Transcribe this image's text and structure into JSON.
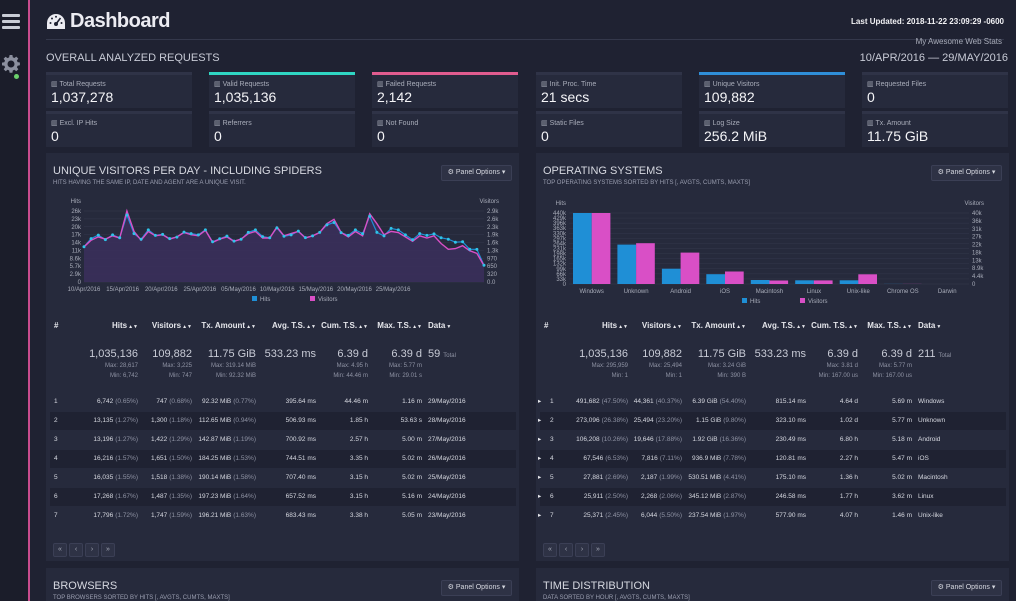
{
  "header": {
    "title": "Dashboard",
    "last_updated": "Last Updated: 2018-11-22 23:09:29 -0600",
    "site_name": "My Awesome Web Stats"
  },
  "overall": {
    "title": "OVERALL ANALYZED REQUESTS",
    "date_range": "10/APR/2016 — 29/MAY/2016",
    "cards": [
      {
        "label": "Total Requests",
        "value": "1,037,278",
        "accent": ""
      },
      {
        "label": "Valid Requests",
        "value": "1,035,136",
        "accent": "#2fd6c3"
      },
      {
        "label": "Failed Requests",
        "value": "2,142",
        "accent": "#e05c8f"
      },
      {
        "label": "Init. Proc. Time",
        "value": "21 secs",
        "accent": ""
      },
      {
        "label": "Unique Visitors",
        "value": "109,882",
        "accent": "#2f8ed8"
      },
      {
        "label": "Requested Files",
        "value": "0",
        "accent": ""
      },
      {
        "label": "Excl. IP Hits",
        "value": "0",
        "accent": ""
      },
      {
        "label": "Referrers",
        "value": "0",
        "accent": ""
      },
      {
        "label": "Not Found",
        "value": "0",
        "accent": ""
      },
      {
        "label": "Static Files",
        "value": "0",
        "accent": ""
      },
      {
        "label": "Log Size",
        "value": "256.2 MiB",
        "accent": ""
      },
      {
        "label": "Tx. Amount",
        "value": "11.75 GiB",
        "accent": ""
      }
    ]
  },
  "panel_options_label": "Panel Options",
  "colors": {
    "hits": "#1f8fd6",
    "visitors": "#d94fc6",
    "visitors_area": "#3b2f5c"
  },
  "visitors_panel": {
    "title": "UNIQUE VISITORS PER DAY - INCLUDING SPIDERS",
    "subtitle": "HITS HAVING THE SAME IP, DATE AND AGENT ARE A UNIQUE VISIT.",
    "columns": [
      "#",
      "Hits",
      "Visitors",
      "Tx. Amount",
      "Avg. T.S.",
      "Cum. T.S.",
      "Max. T.S.",
      "Data"
    ],
    "totals": {
      "hits": "1,035,136",
      "hits_max": "Max: 28,617",
      "hits_min": "Min: 6,742",
      "visitors": "109,882",
      "visitors_max": "Max: 3,225",
      "visitors_min": "Min: 747",
      "tx": "11.75 GiB",
      "tx_max": "Max: 319.14 MiB",
      "tx_min": "Min: 92.32 MiB",
      "avg": "533.23 ms",
      "cum": "6.39 d",
      "cum_max": "Max: 4.95 h",
      "cum_min": "Min: 44.46 m",
      "max": "6.39 d",
      "max_max": "Max: 5.77 m",
      "max_min": "Min: 29.01 s",
      "data": "59",
      "data_label": "Total"
    },
    "rows": [
      {
        "n": "1",
        "hits": "6,742",
        "hits_pct": "(0.65%)",
        "visitors": "747",
        "visitors_pct": "(0.68%)",
        "tx": "92.32 MiB",
        "tx_pct": "(0.77%)",
        "avg": "395.64 ms",
        "cum": "44.46 m",
        "max": "1.16 m",
        "data": "29/May/2016"
      },
      {
        "n": "2",
        "hits": "13,135",
        "hits_pct": "(1.27%)",
        "visitors": "1,300",
        "visitors_pct": "(1.18%)",
        "tx": "112.65 MiB",
        "tx_pct": "(0.94%)",
        "avg": "506.93 ms",
        "cum": "1.85 h",
        "max": "53.63 s",
        "data": "28/May/2016"
      },
      {
        "n": "3",
        "hits": "13,196",
        "hits_pct": "(1.27%)",
        "visitors": "1,422",
        "visitors_pct": "(1.29%)",
        "tx": "142.87 MiB",
        "tx_pct": "(1.19%)",
        "avg": "700.92 ms",
        "cum": "2.57 h",
        "max": "5.00 m",
        "data": "27/May/2016"
      },
      {
        "n": "4",
        "hits": "16,216",
        "hits_pct": "(1.57%)",
        "visitors": "1,651",
        "visitors_pct": "(1.50%)",
        "tx": "184.25 MiB",
        "tx_pct": "(1.53%)",
        "avg": "744.51 ms",
        "cum": "3.35 h",
        "max": "5.02 m",
        "data": "26/May/2016"
      },
      {
        "n": "5",
        "hits": "16,035",
        "hits_pct": "(1.55%)",
        "visitors": "1,518",
        "visitors_pct": "(1.38%)",
        "tx": "190.14 MiB",
        "tx_pct": "(1.58%)",
        "avg": "707.40 ms",
        "cum": "3.15 h",
        "max": "5.02 m",
        "data": "25/May/2016"
      },
      {
        "n": "6",
        "hits": "17,268",
        "hits_pct": "(1.67%)",
        "visitors": "1,487",
        "visitors_pct": "(1.35%)",
        "tx": "197.23 MiB",
        "tx_pct": "(1.64%)",
        "avg": "657.52 ms",
        "cum": "3.15 h",
        "max": "5.16 m",
        "data": "24/May/2016"
      },
      {
        "n": "7",
        "hits": "17,796",
        "hits_pct": "(1.72%)",
        "visitors": "1,747",
        "visitors_pct": "(1.59%)",
        "tx": "196.21 MiB",
        "tx_pct": "(1.63%)",
        "avg": "683.43 ms",
        "cum": "3.38 h",
        "max": "5.05 m",
        "data": "23/May/2016"
      }
    ],
    "pager": [
      "«",
      "‹",
      "›",
      "»"
    ]
  },
  "os_panel": {
    "title": "OPERATING SYSTEMS",
    "subtitle": "TOP OPERATING SYSTEMS SORTED BY HITS [, AVGTS, CUMTS, MAXTS]",
    "columns": [
      "#",
      "Hits",
      "Visitors",
      "Tx. Amount",
      "Avg. T.S.",
      "Cum. T.S.",
      "Max. T.S.",
      "Data"
    ],
    "totals": {
      "hits": "1,035,136",
      "hits_max": "Max: 295,959",
      "hits_min": "Min: 1",
      "visitors": "109,882",
      "visitors_max": "Max: 25,494",
      "visitors_min": "Min: 1",
      "tx": "11.75 GiB",
      "tx_max": "Max: 3.24 GiB",
      "tx_min": "Min: 390 B",
      "avg": "533.23 ms",
      "cum": "6.39 d",
      "cum_max": "Max: 3.81 d",
      "cum_min": "Min: 167.00 us",
      "max": "6.39 d",
      "max_max": "Max: 5.77 m",
      "max_min": "Min: 167.00 us",
      "data": "211",
      "data_label": "Total"
    },
    "rows": [
      {
        "n": "1",
        "hits": "491,682",
        "hits_pct": "(47.50%)",
        "visitors": "44,361",
        "visitors_pct": "(40.37%)",
        "tx": "6.39 GiB",
        "tx_pct": "(54.40%)",
        "avg": "815.14 ms",
        "cum": "4.64 d",
        "max": "5.69 m",
        "data": "Windows"
      },
      {
        "n": "2",
        "hits": "273,096",
        "hits_pct": "(26.38%)",
        "visitors": "25,494",
        "visitors_pct": "(23.20%)",
        "tx": "1.15 GiB",
        "tx_pct": "(9.80%)",
        "avg": "323.10 ms",
        "cum": "1.02 d",
        "max": "5.77 m",
        "data": "Unknown"
      },
      {
        "n": "3",
        "hits": "106,208",
        "hits_pct": "(10.26%)",
        "visitors": "19,646",
        "visitors_pct": "(17.88%)",
        "tx": "1.92 GiB",
        "tx_pct": "(16.36%)",
        "avg": "230.49 ms",
        "cum": "6.80 h",
        "max": "5.18 m",
        "data": "Android"
      },
      {
        "n": "4",
        "hits": "67,546",
        "hits_pct": "(6.53%)",
        "visitors": "7,816",
        "visitors_pct": "(7.11%)",
        "tx": "936.9 MiB",
        "tx_pct": "(7.78%)",
        "avg": "120.81 ms",
        "cum": "2.27 h",
        "max": "5.47 m",
        "data": "iOS"
      },
      {
        "n": "5",
        "hits": "27,881",
        "hits_pct": "(2.69%)",
        "visitors": "2,187",
        "visitors_pct": "(1.99%)",
        "tx": "530.51 MiB",
        "tx_pct": "(4.41%)",
        "avg": "175.10 ms",
        "cum": "1.36 h",
        "max": "5.02 m",
        "data": "Macintosh"
      },
      {
        "n": "6",
        "hits": "25,911",
        "hits_pct": "(2.50%)",
        "visitors": "2,268",
        "visitors_pct": "(2.06%)",
        "tx": "345.12 MiB",
        "tx_pct": "(2.87%)",
        "avg": "246.58 ms",
        "cum": "1.77 h",
        "max": "3.62 m",
        "data": "Linux"
      },
      {
        "n": "7",
        "hits": "25,371",
        "hits_pct": "(2.45%)",
        "visitors": "6,044",
        "visitors_pct": "(5.50%)",
        "tx": "237.54 MiB",
        "tx_pct": "(1.97%)",
        "avg": "577.90 ms",
        "cum": "4.07 h",
        "max": "1.46 m",
        "data": "Unix-like"
      }
    ],
    "pager": [
      "«",
      "‹",
      "›",
      "»"
    ]
  },
  "browsers_panel": {
    "title": "BROWSERS",
    "subtitle": "TOP BROWSERS SORTED BY HITS [, AVGTS, CUMTS, MAXTS]"
  },
  "time_panel": {
    "title": "TIME DISTRIBUTION",
    "subtitle": "DATA SORTED BY HOUR [, AVGTS, CUMTS, MAXTS]"
  },
  "chart_data": [
    {
      "type": "line",
      "title": "UNIQUE VISITORS PER DAY - INCLUDING SPIDERS",
      "ylabel": "Hits",
      "y2label": "Visitors",
      "yticks": [
        "0",
        "2.9k",
        "5.7k",
        "8.6k",
        "11k",
        "14k",
        "17k",
        "20k",
        "23k",
        "26k"
      ],
      "y2ticks": [
        "0.0",
        "320",
        "650",
        "970",
        "1.3k",
        "1.6k",
        "1.9k",
        "2.3k",
        "2.6k",
        "2.9k"
      ],
      "xticks": [
        "10/Apr/2016",
        "15/Apr/2016",
        "20/Apr/2016",
        "25/Apr/2016",
        "05/May/2016",
        "10/May/2016",
        "15/May/2016",
        "20/May/2016",
        "25/May/2016"
      ],
      "ylim": [
        0,
        28617
      ],
      "y2lim": [
        0,
        3225
      ],
      "legend": [
        "Hits",
        "Visitors"
      ],
      "series": [
        {
          "name": "Hits",
          "values": [
            14200,
            17500,
            18900,
            17100,
            19000,
            17800,
            27000,
            19500,
            17200,
            21000,
            18800,
            19200,
            17500,
            18100,
            20100,
            19500,
            19000,
            21000,
            16200,
            17400,
            18500,
            16500,
            17200,
            20000,
            21000,
            18300,
            17800,
            21800,
            18400,
            19000,
            20500,
            17900,
            18600,
            20000,
            23000,
            24000,
            19900,
            18800,
            21000,
            19500,
            26500,
            20000,
            18600,
            21600,
            21000,
            19000,
            17000,
            19500,
            18800,
            19400,
            17796,
            17268,
            16035,
            16216,
            13196,
            13135,
            6742
          ]
        },
        {
          "name": "Visitors",
          "values": [
            1600,
            1900,
            2050,
            1950,
            2100,
            2000,
            3225,
            2300,
            1900,
            2300,
            2100,
            2150,
            1950,
            2050,
            2250,
            2150,
            2100,
            2350,
            1800,
            1950,
            2050,
            1850,
            1950,
            2200,
            2300,
            2000,
            2000,
            2500,
            2100,
            2200,
            2300,
            2000,
            2100,
            2250,
            2650,
            2850,
            2250,
            2050,
            2300,
            2100,
            3100,
            2650,
            2150,
            2300,
            2250,
            2050,
            1850,
            2100,
            2000,
            2100,
            1747,
            1487,
            1518,
            1651,
            1422,
            1300,
            747
          ]
        }
      ]
    },
    {
      "type": "bar",
      "title": "OPERATING SYSTEMS",
      "ylabel": "Hits",
      "y2label": "Visitors",
      "yticks": [
        "0",
        "33k",
        "66k",
        "99k",
        "132k",
        "165k",
        "198k",
        "231k",
        "264k",
        "297k",
        "330k",
        "363k",
        "396k",
        "429k",
        "440k"
      ],
      "y2ticks": [
        "0",
        "4.4k",
        "8.9k",
        "13k",
        "18k",
        "22k",
        "27k",
        "31k",
        "36k",
        "40k"
      ],
      "categories": [
        "Windows",
        "Unknown",
        "Android",
        "iOS",
        "Macintosh",
        "Linux",
        "Unix-like",
        "Chrome OS",
        "Darwin"
      ],
      "ylim": [
        0,
        491682
      ],
      "y2lim": [
        0,
        44361
      ],
      "legend": [
        "Hits",
        "Visitors"
      ],
      "series": [
        {
          "name": "Hits",
          "values": [
            491682,
            273096,
            106208,
            67546,
            27881,
            25911,
            25371,
            800,
            200
          ]
        },
        {
          "name": "Visitors",
          "values": [
            44361,
            25494,
            19646,
            7816,
            2187,
            2268,
            6044,
            60,
            20
          ]
        }
      ]
    }
  ]
}
